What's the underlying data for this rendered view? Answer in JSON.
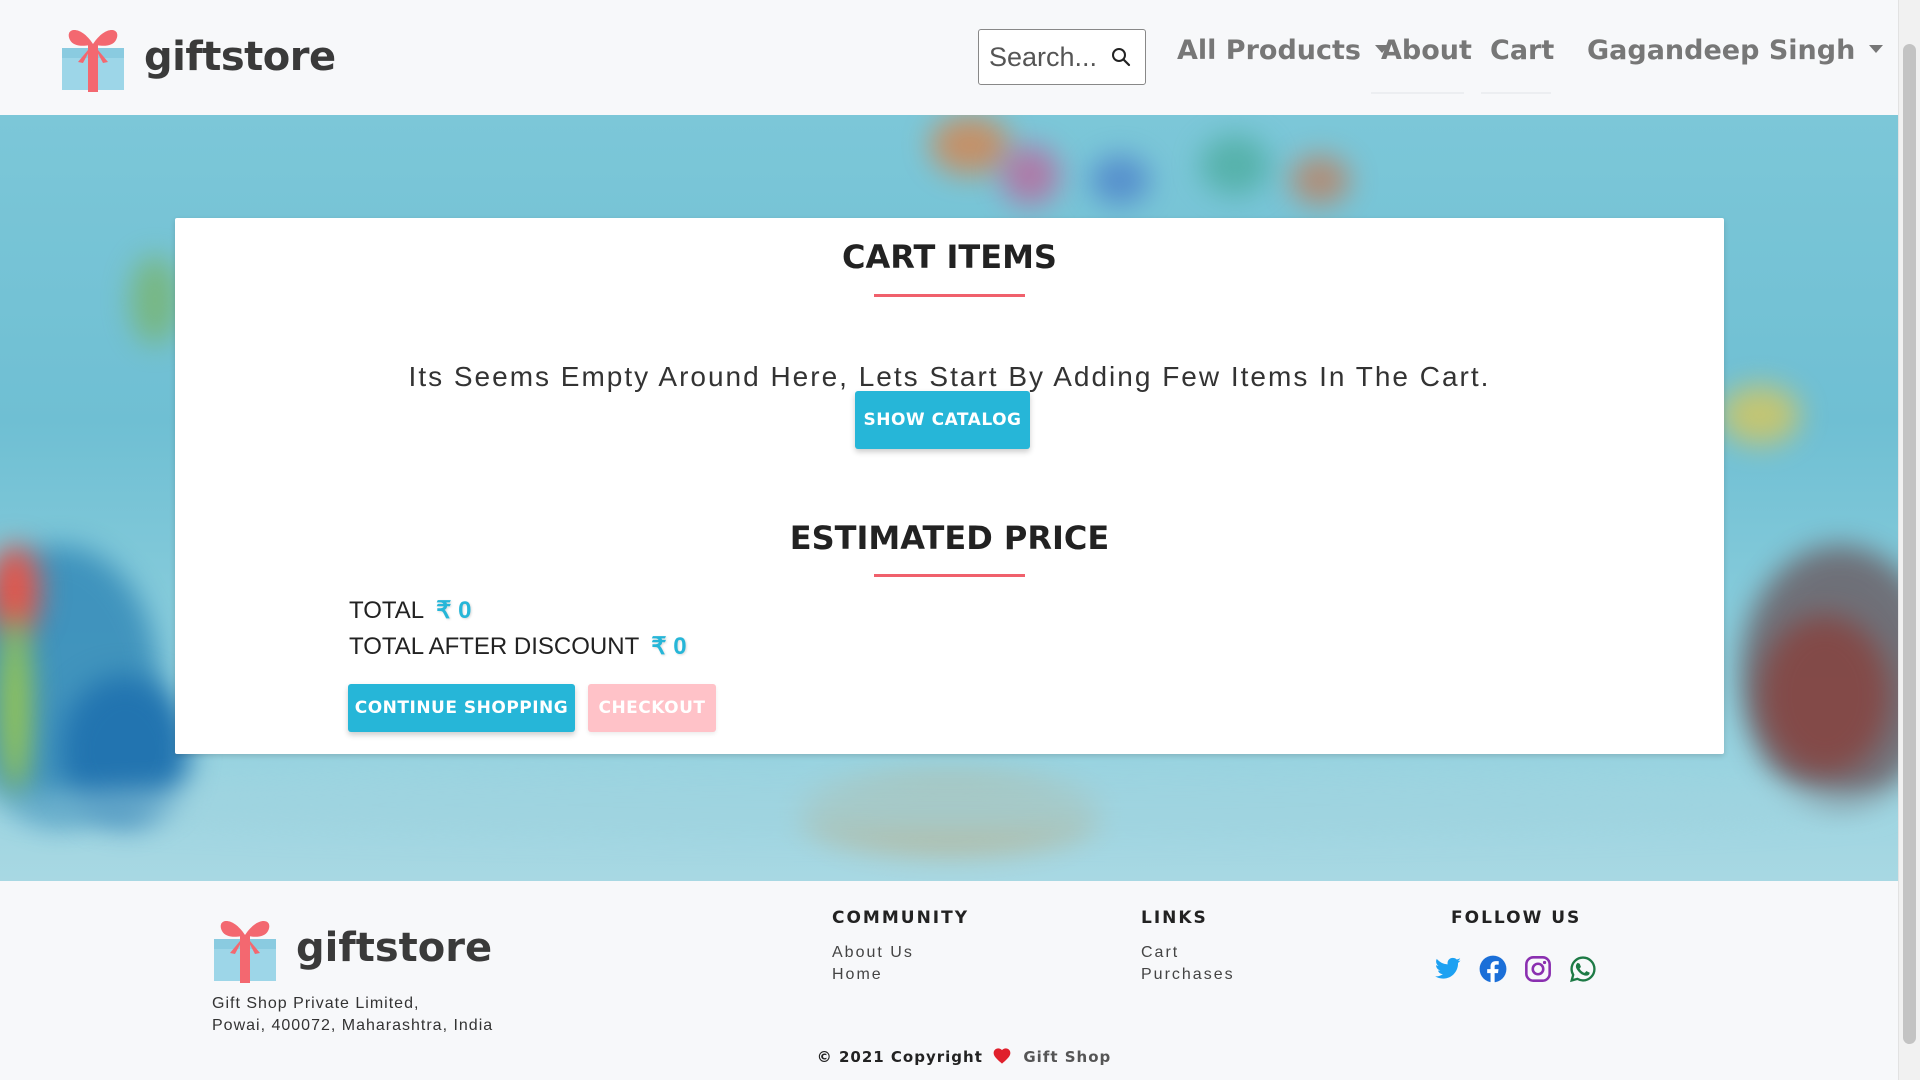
{
  "navbar": {
    "brand": "giftstore",
    "search_placeholder": "Search...",
    "items": [
      {
        "label": "All Products"
      },
      {
        "label": "About"
      },
      {
        "label": "Cart"
      },
      {
        "label": "Gagandeep Singh"
      }
    ]
  },
  "cart": {
    "title": "CART ITEMS",
    "empty_message": "Its Seems Empty Around Here, Lets Start By Adding Few Items In The Cart.",
    "show_catalog": "SHOW CATALOG"
  },
  "price": {
    "title": "ESTIMATED PRICE",
    "total_label": "TOTAL",
    "total_value": "₹ 0",
    "discount_label": "TOTAL AFTER DISCOUNT",
    "discount_value": "₹ 0",
    "continue_button": "CONTINUE SHOPPING",
    "checkout_button": "CHECKOUT"
  },
  "footer": {
    "brand": "giftstore",
    "address_line1": "Gift Shop Private Limited,",
    "address_line2": "Powai, 400072, Maharashtra, India",
    "community_heading": "COMMUNITY",
    "community_links": [
      "About Us",
      "Home"
    ],
    "links_heading": "LINKS",
    "links": [
      "Cart",
      "Purchases"
    ],
    "follow_heading": "FOLLOW US",
    "social_icons": [
      "twitter-icon",
      "facebook-icon",
      "instagram-icon",
      "whatsapp-icon"
    ],
    "copyright": "© 2021 Copyright",
    "copyright_name": "Gift Shop"
  },
  "colors": {
    "accent": "#26b6d8",
    "title_underline": "#f0606c",
    "checkout_disabled": "#ffc2c8"
  }
}
